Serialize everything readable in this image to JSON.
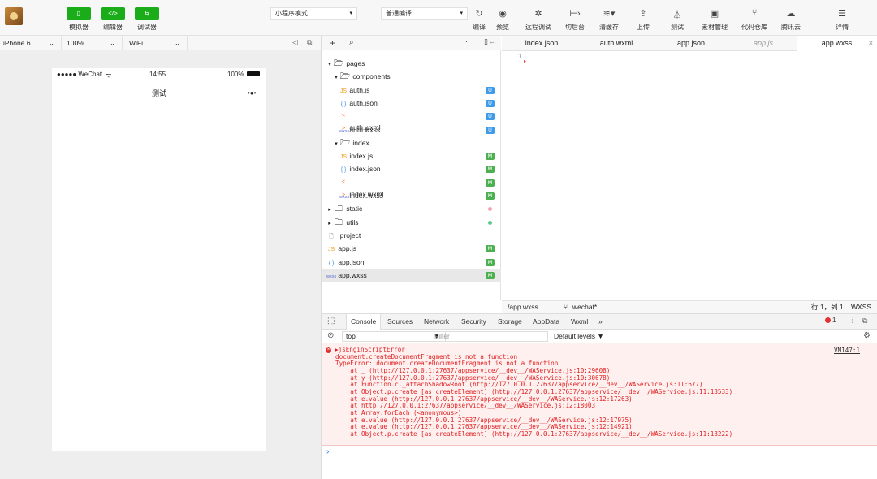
{
  "toolbar": {
    "simulator_label": "模拟器",
    "editor_label": "编辑器",
    "debugger_label": "调试器",
    "mode_select": "小程序模式",
    "compile_select": "普通编译",
    "compile_label": "编译",
    "preview_label": "预览",
    "remote_debug_label": "远程调试",
    "background_label": "切后台",
    "clear_cache_label": "清缓存",
    "upload_label": "上传",
    "test_label": "测试",
    "material_label": "素材管理",
    "repo_label": "代码仓库",
    "tencent_cloud_label": "腾讯云",
    "details_label": "详情"
  },
  "simulator": {
    "device": "iPhone 6",
    "zoom": "100%",
    "network": "WiFi",
    "status_left": "●●●●● WeChat",
    "time": "14:55",
    "battery": "100%",
    "nav_title": "测试",
    "menu_dots": "•●•"
  },
  "filetree": {
    "items": [
      {
        "name": "pages",
        "kind": "folder-open",
        "indent": 0
      },
      {
        "name": "components",
        "kind": "folder-open",
        "indent": 1
      },
      {
        "name": "auth.js",
        "kind": "js",
        "indent": 2,
        "badge": "U"
      },
      {
        "name": "auth.json",
        "kind": "json",
        "indent": 2,
        "badge": "U"
      },
      {
        "name": "auth.wxml",
        "kind": "wxml",
        "indent": 2,
        "badge": "U"
      },
      {
        "name": "auth.wxss",
        "kind": "wxss",
        "indent": 2,
        "badge": "U"
      },
      {
        "name": "index",
        "kind": "folder-open",
        "indent": 1
      },
      {
        "name": "index.js",
        "kind": "js",
        "indent": 2,
        "badge": "M"
      },
      {
        "name": "index.json",
        "kind": "json",
        "indent": 2,
        "badge": "M"
      },
      {
        "name": "index.wxml",
        "kind": "wxml",
        "indent": 2,
        "badge": "M"
      },
      {
        "name": "index.wxss",
        "kind": "wxss",
        "indent": 2,
        "badge": "M"
      },
      {
        "name": "static",
        "kind": "folder-closed",
        "indent": 0,
        "dot": "#f4a0b0"
      },
      {
        "name": "utils",
        "kind": "folder-closed",
        "indent": 0,
        "dot": "#5cc98a"
      },
      {
        "name": ".project",
        "kind": "file",
        "indent": 0
      },
      {
        "name": "app.js",
        "kind": "js",
        "indent": 0,
        "badge": "M"
      },
      {
        "name": "app.json",
        "kind": "json",
        "indent": 0,
        "badge": "M"
      },
      {
        "name": "app.wxss",
        "kind": "wxss",
        "indent": 0,
        "badge": "M",
        "selected": true
      }
    ]
  },
  "editor": {
    "tabs": [
      "index.json",
      "auth.wxml",
      "app.json",
      "app.js",
      "app.wxss"
    ],
    "active_tab": "app.wxss",
    "line_number": "1",
    "status_path": "/app.wxss",
    "status_branch": "wechat*",
    "status_pos": "行 1，列 1",
    "status_lang": "WXSS"
  },
  "devtools": {
    "tabs": [
      "Console",
      "Sources",
      "Network",
      "Security",
      "Storage",
      "AppData",
      "Wxml"
    ],
    "more": "»",
    "error_count": "1",
    "context": "top",
    "filter_placeholder": "Filter",
    "levels": "Default levels ▼",
    "vm_link": "VM147:1",
    "error_lines": [
      "▶jsEnginScriptError",
      "document.createDocumentFragment is not a function",
      "TypeError: document.createDocumentFragment is not a function",
      "    at _ (http://127.0.0.1:27637/appservice/__dev__/WAService.js:10:29608)",
      "    at y (http://127.0.0.1:27637/appservice/__dev__/WAService.js:10:30678)",
      "    at Function.c._attachShadowRoot (http://127.0.0.1:27637/appservice/__dev__/WAService.js:11:677)",
      "    at Object.p.create [as createElement] (http://127.0.0.1:27637/appservice/__dev__/WAService.js:11:13533)",
      "    at e.value (http://127.0.0.1:27637/appservice/__dev__/WAService.js:12:17263)",
      "    at http://127.0.0.1:27637/appservice/__dev__/WAService.js:12:18003",
      "    at Array.forEach (<anonymous>)",
      "    at e.value (http://127.0.0.1:27637/appservice/__dev__/WAService.js:12:17975)",
      "    at e.value (http://127.0.0.1:27637/appservice/__dev__/WAService.js:12:14921)",
      "    at Object.p.create [as createElement] (http://127.0.0.1:27637/appservice/__dev__/WAService.js:11:13222)"
    ],
    "prompt": "›"
  },
  "colors": {
    "green": "#1aad19",
    "badge_u": "#3d9be9",
    "badge_m": "#4caf50",
    "error": "#e02020"
  }
}
